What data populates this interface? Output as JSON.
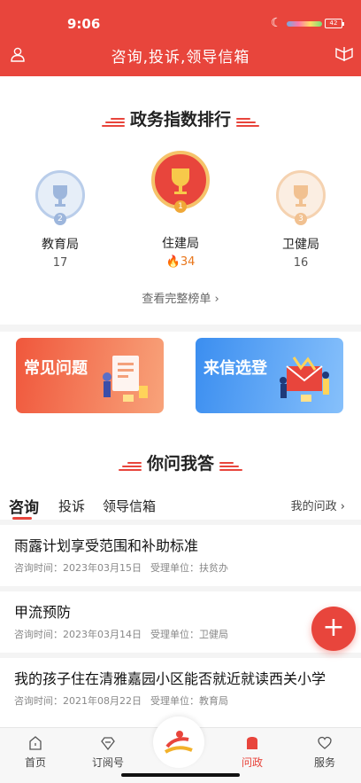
{
  "status": {
    "time": "9:06",
    "battery": "42"
  },
  "header": {
    "title": "咨询,投诉,领导信箱"
  },
  "ranking": {
    "title": "政务指数排行",
    "items": [
      {
        "rank": "2",
        "name": "教育局",
        "score": "17"
      },
      {
        "rank": "1",
        "name": "住建局",
        "score": "34"
      },
      {
        "rank": "3",
        "name": "卫健局",
        "score": "16"
      }
    ],
    "full_list": "查看完整榜单"
  },
  "cards": {
    "faq": "常见问题",
    "letter": "来信选登"
  },
  "qa": {
    "title": "你问我答",
    "tabs": [
      "咨询",
      "投诉",
      "领导信箱"
    ],
    "my_link": "我的问政",
    "items": [
      {
        "title": "雨露计划享受范围和补助标准",
        "time": "咨询时间：2023年03月15日",
        "unit": "受理单位：扶贫办"
      },
      {
        "title": "甲流预防",
        "time": "咨询时间：2023年03月14日",
        "unit": "受理单位：卫健局"
      },
      {
        "title": "我的孩子住在清雅嘉园小区能否就近就读西关小学",
        "time": "咨询时间：2021年08月22日",
        "unit": "受理单位：教育局"
      }
    ]
  },
  "nav": {
    "home": "首页",
    "subscribe": "订阅号",
    "politics": "问政",
    "service": "服务"
  },
  "colors": {
    "primary": "#e8453c",
    "blue": "#3b8ef0"
  }
}
